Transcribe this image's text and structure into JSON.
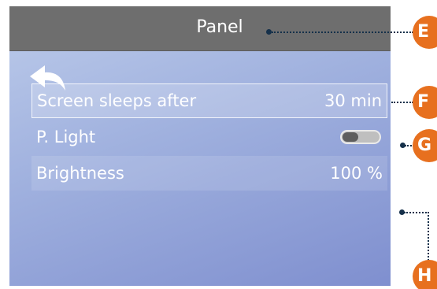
{
  "panel": {
    "title": "Panel",
    "rows": [
      {
        "label": "Screen sleeps after",
        "value": "30 min"
      },
      {
        "label": "P. Light",
        "toggle_state": "off"
      },
      {
        "label": "Brightness",
        "value": "100 %"
      }
    ]
  },
  "icons": {
    "back": "back-arrow-icon"
  },
  "callouts": {
    "title_bar": "E",
    "sleep_row": "F",
    "light_toggle": "G",
    "brightness_row": "H"
  },
  "colors": {
    "title_bar": "#6e6e6e",
    "screen_gradient_top": "#bccbea",
    "screen_gradient_bottom": "#7f8fcf",
    "callout_badge": "#e7701f",
    "callout_line": "#15304a",
    "toggle_track": "#bfbfbf",
    "toggle_knob": "#5e5e5e"
  }
}
